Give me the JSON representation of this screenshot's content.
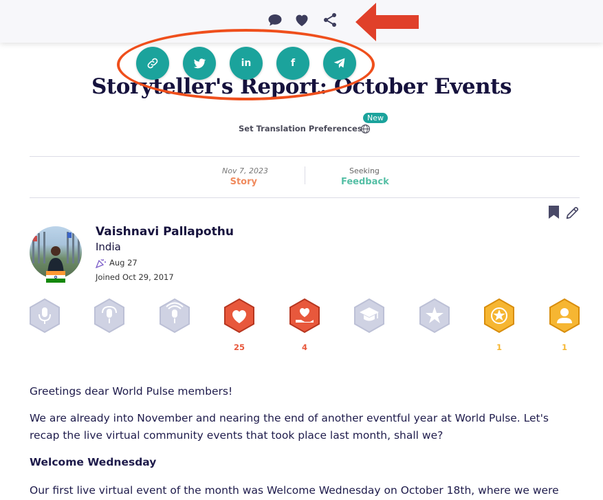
{
  "toolbar": {
    "icons": [
      "comment-icon",
      "heart-icon",
      "share-icon"
    ]
  },
  "share_menu": {
    "buttons": [
      "link-icon",
      "twitter-icon",
      "linkedin-icon",
      "facebook-icon",
      "telegram-icon"
    ],
    "linkedin_text": "in",
    "facebook_text": "f"
  },
  "title": "Storyteller's Report: October Events",
  "translation": {
    "label": "Set Translation Preferences",
    "badge": "New"
  },
  "meta": {
    "date": "Nov 7, 2023",
    "type": "Story",
    "seeking_label": "Seeking",
    "seeking_value": "Feedback"
  },
  "author": {
    "name": "Vaishnavi Pallapothu",
    "country": "India",
    "birthday": "Aug 27",
    "joined": "Joined Oct 29, 2017"
  },
  "badges": [
    {
      "name": "microphone-badge",
      "count": ""
    },
    {
      "name": "podcast-badge",
      "count": ""
    },
    {
      "name": "broadcast-badge",
      "count": ""
    },
    {
      "name": "heart-badge",
      "count": "25"
    },
    {
      "name": "heart-hand-badge",
      "count": "4"
    },
    {
      "name": "graduation-badge",
      "count": ""
    },
    {
      "name": "star-badge",
      "count": ""
    },
    {
      "name": "star-circle-badge",
      "count": "1"
    },
    {
      "name": "person-badge",
      "count": "1"
    }
  ],
  "article": {
    "p1": "Greetings dear World Pulse members!",
    "p2": "We are already into November and nearing the end of another eventful year at World Pulse. Let's recap the live virtual community events that took place last month, shall we?",
    "h1": "Welcome Wednesday",
    "p3": "Our first live virtual event of the month was Welcome Wednesday on October 18th, where we were"
  },
  "colors": {
    "accent_teal": "#1ba39c",
    "orange": "#f08a5d",
    "feedback_green": "#55bfa5",
    "annotation_red": "#ef4f1c",
    "title_navy": "#16123d",
    "badge_gray": "#cfd2e3",
    "badge_red": "#e8583c",
    "badge_gold": "#f6b632"
  }
}
